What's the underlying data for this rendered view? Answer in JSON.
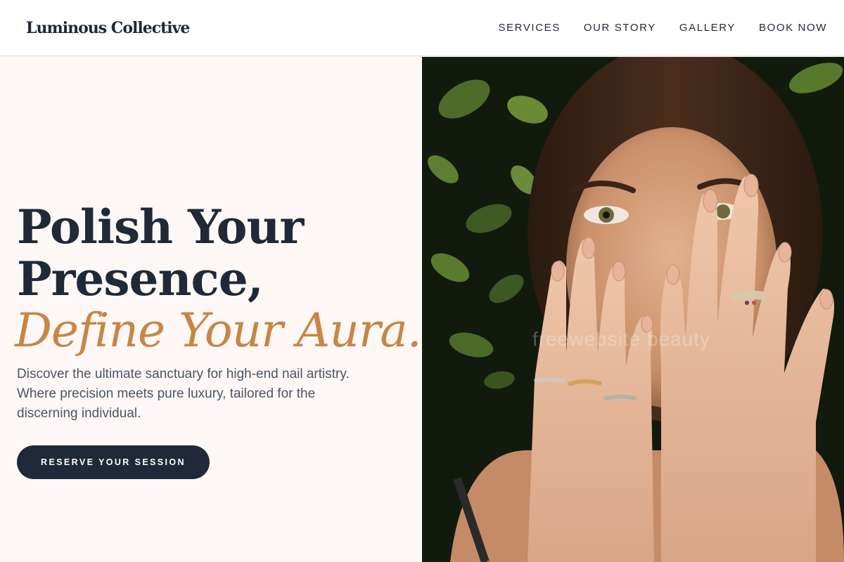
{
  "header": {
    "logo": "Luminous Collective",
    "nav": [
      {
        "label": "SERVICES"
      },
      {
        "label": "OUR STORY"
      },
      {
        "label": "GALLERY"
      },
      {
        "label": "BOOK NOW"
      }
    ]
  },
  "hero": {
    "headline_line1": "Polish Your",
    "headline_line2": "Presence,",
    "headline_accent": "Define Your Aura.",
    "description": "Discover the ultimate sanctuary for high-end nail artistry. Where precision meets pure luxury, tailored for the discerning individual.",
    "cta_label": "RESERVE YOUR SESSION"
  },
  "photo": {
    "watermark": "freewebsite beauty"
  },
  "colors": {
    "navy": "#1f2937",
    "accent": "#c98545",
    "background": "#fdf8f6",
    "body_text": "#4b5563"
  }
}
